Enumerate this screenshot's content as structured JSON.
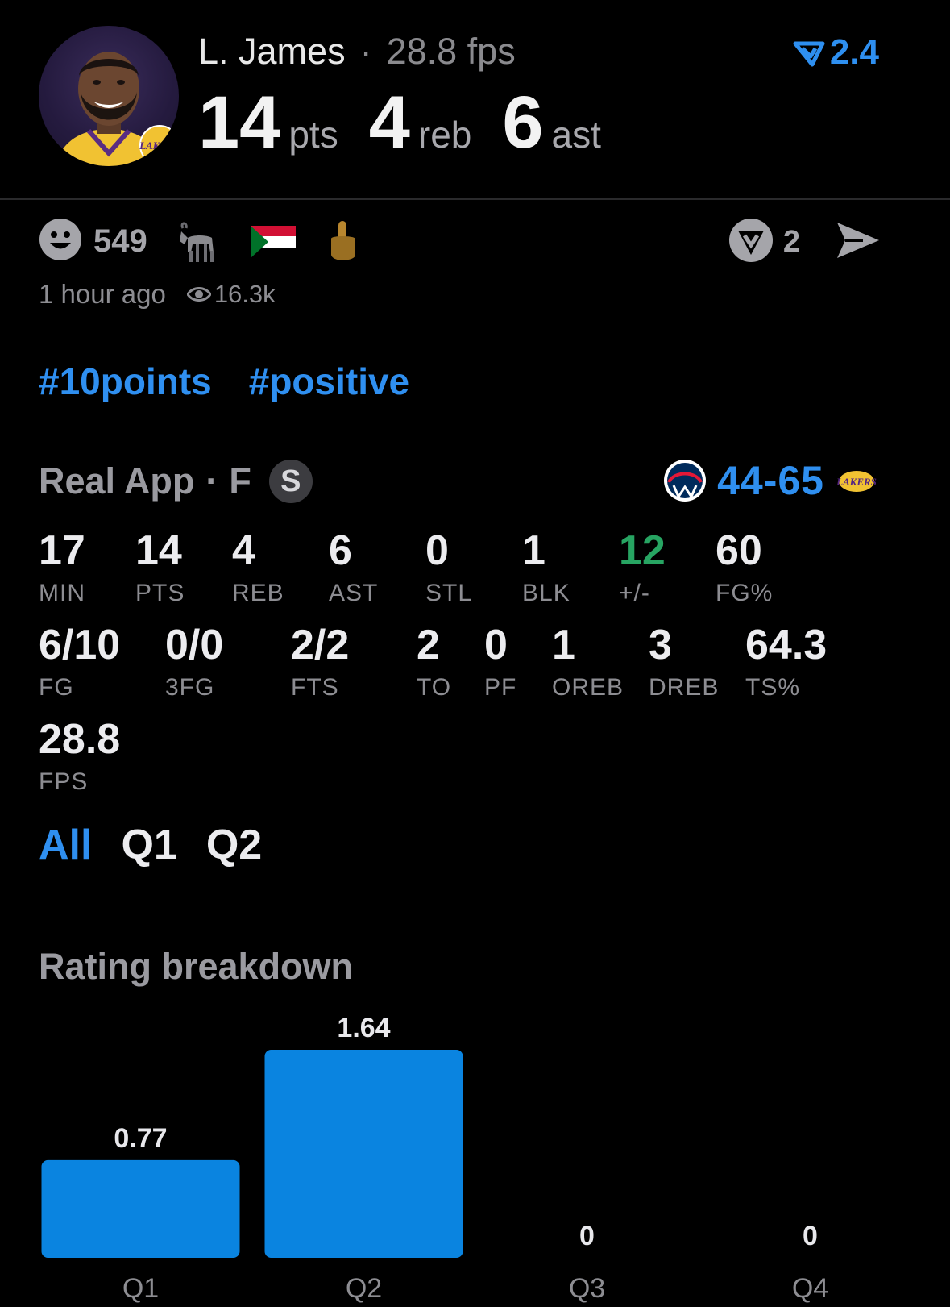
{
  "header": {
    "player_name": "L. James",
    "separator": "·",
    "fps_text": "28.8 fps",
    "pts_value": "14",
    "pts_label": "pts",
    "reb_value": "4",
    "reb_label": "reb",
    "ast_value": "6",
    "ast_label": "ast",
    "rating": "2.4",
    "accent": "#2e8ff0"
  },
  "reactions": {
    "smile_count": "549",
    "action_count": "2"
  },
  "meta": {
    "time_ago": "1 hour ago",
    "views": "16.3k"
  },
  "tags": [
    "#10points",
    "#positive"
  ],
  "game": {
    "source": "Real App",
    "separator": "·",
    "position": "F",
    "badge": "S",
    "score": "44-65"
  },
  "stats_row1": [
    {
      "value": "17",
      "label": "MIN"
    },
    {
      "value": "14",
      "label": "PTS"
    },
    {
      "value": "4",
      "label": "REB"
    },
    {
      "value": "6",
      "label": "AST"
    },
    {
      "value": "0",
      "label": "STL"
    },
    {
      "value": "1",
      "label": "BLK"
    },
    {
      "value": "12",
      "label": "+/-",
      "positive": true
    },
    {
      "value": "60",
      "label": "FG%"
    }
  ],
  "stats_row2": [
    {
      "value": "6/10",
      "label": "FG"
    },
    {
      "value": "0/0",
      "label": "3FG"
    },
    {
      "value": "2/2",
      "label": "FTS"
    },
    {
      "value": "2",
      "label": "TO"
    },
    {
      "value": "0",
      "label": "PF"
    },
    {
      "value": "1",
      "label": "OREB"
    },
    {
      "value": "3",
      "label": "DREB"
    },
    {
      "value": "64.3",
      "label": "TS%"
    }
  ],
  "stats_row3": [
    {
      "value": "28.8",
      "label": "FPS"
    }
  ],
  "filters": {
    "all": "All",
    "q1": "Q1",
    "q2": "Q2",
    "active": "all"
  },
  "rating_breakdown": {
    "title": "Rating breakdown"
  },
  "chart_data": {
    "type": "bar",
    "title": "Rating breakdown",
    "categories": [
      "Q1",
      "Q2",
      "Q3",
      "Q4"
    ],
    "values": [
      0.77,
      1.64,
      0,
      0
    ],
    "value_labels": [
      "0.77",
      "1.64",
      "0",
      "0"
    ],
    "bar_color": "#0a84e0",
    "grid": false
  }
}
